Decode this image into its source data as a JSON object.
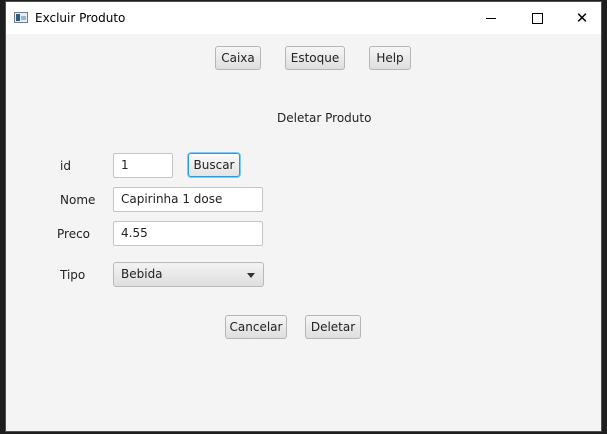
{
  "window": {
    "title": "Excluir  Produto"
  },
  "toolbar": {
    "caixa": "Caixa",
    "estoque": "Estoque",
    "help": "Help"
  },
  "form": {
    "heading": "Deletar Produto",
    "id": {
      "label": "id",
      "value": "1",
      "search_button": "Buscar"
    },
    "nome": {
      "label": "Nome",
      "value": "Capirinha 1 dose"
    },
    "preco": {
      "label": "Preco",
      "value": "4.55"
    },
    "tipo": {
      "label": "Tipo",
      "selected": "Bebida"
    }
  },
  "actions": {
    "cancel": "Cancelar",
    "delete": "Deletar"
  }
}
